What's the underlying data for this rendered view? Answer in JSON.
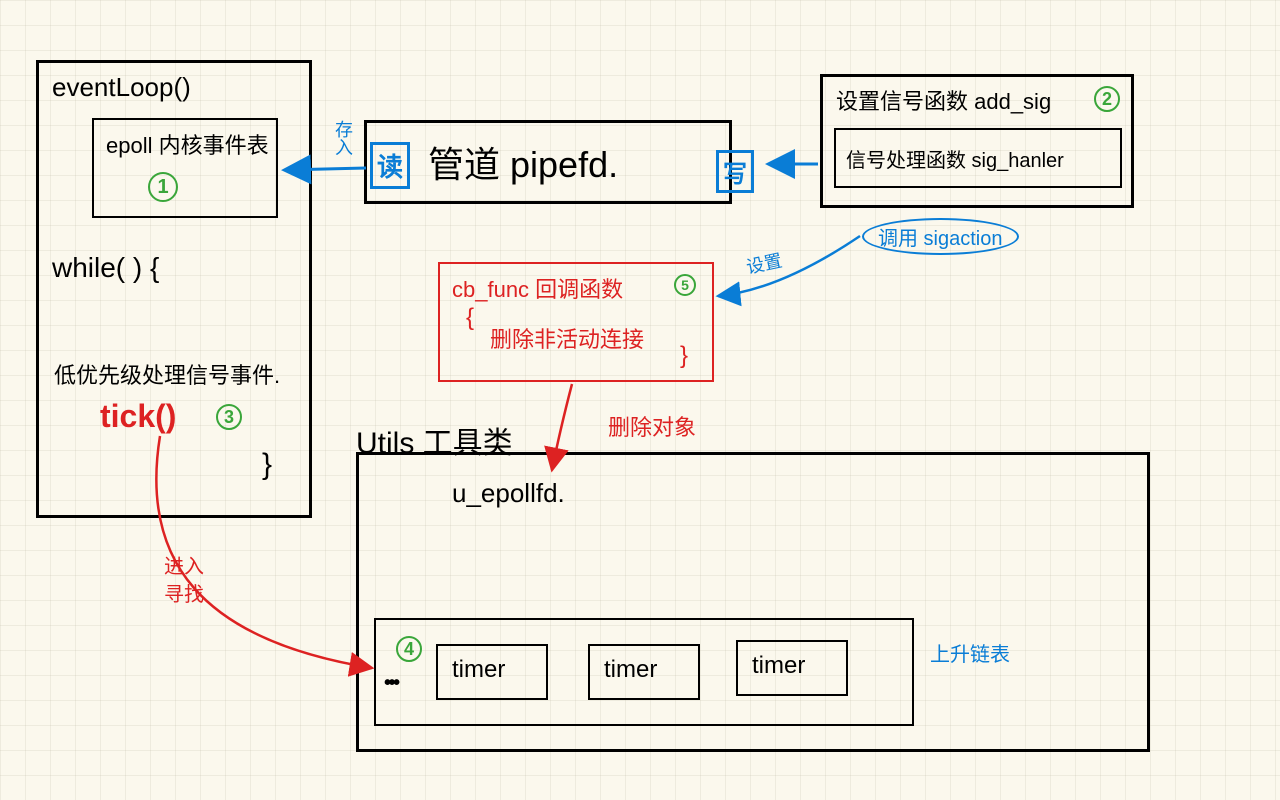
{
  "eventloop": {
    "title": "eventLoop()",
    "epoll_label": "epoll 内核事件表",
    "num1": "1",
    "while": "while( ) {",
    "low_priority": "低优先级处理信号事件.",
    "tick": "tick()",
    "num3": "3",
    "close_brace": "}"
  },
  "arrow_labels": {
    "save_in": "存入",
    "read": "读",
    "write": "写",
    "enter_find_1": "进入",
    "enter_find_2": "寻找",
    "set": "设置",
    "delete_obj": "删除对象"
  },
  "pipe": {
    "title": "管道 pipefd."
  },
  "signal": {
    "title": "设置信号函数 add_sig",
    "num2": "2",
    "handler": "信号处理函数 sig_hanler",
    "sigaction": "调用 sigaction"
  },
  "cbfunc": {
    "title": "cb_func 回调函数",
    "num5": "5",
    "body_open": "{",
    "body_text": "删除非活动连接",
    "body_close": "}"
  },
  "utils": {
    "title": "Utils 工具类",
    "epollfd": "u_epollfd.",
    "num4": "4",
    "dots": "• • •",
    "timer": "timer",
    "uplink": "上升链表"
  }
}
